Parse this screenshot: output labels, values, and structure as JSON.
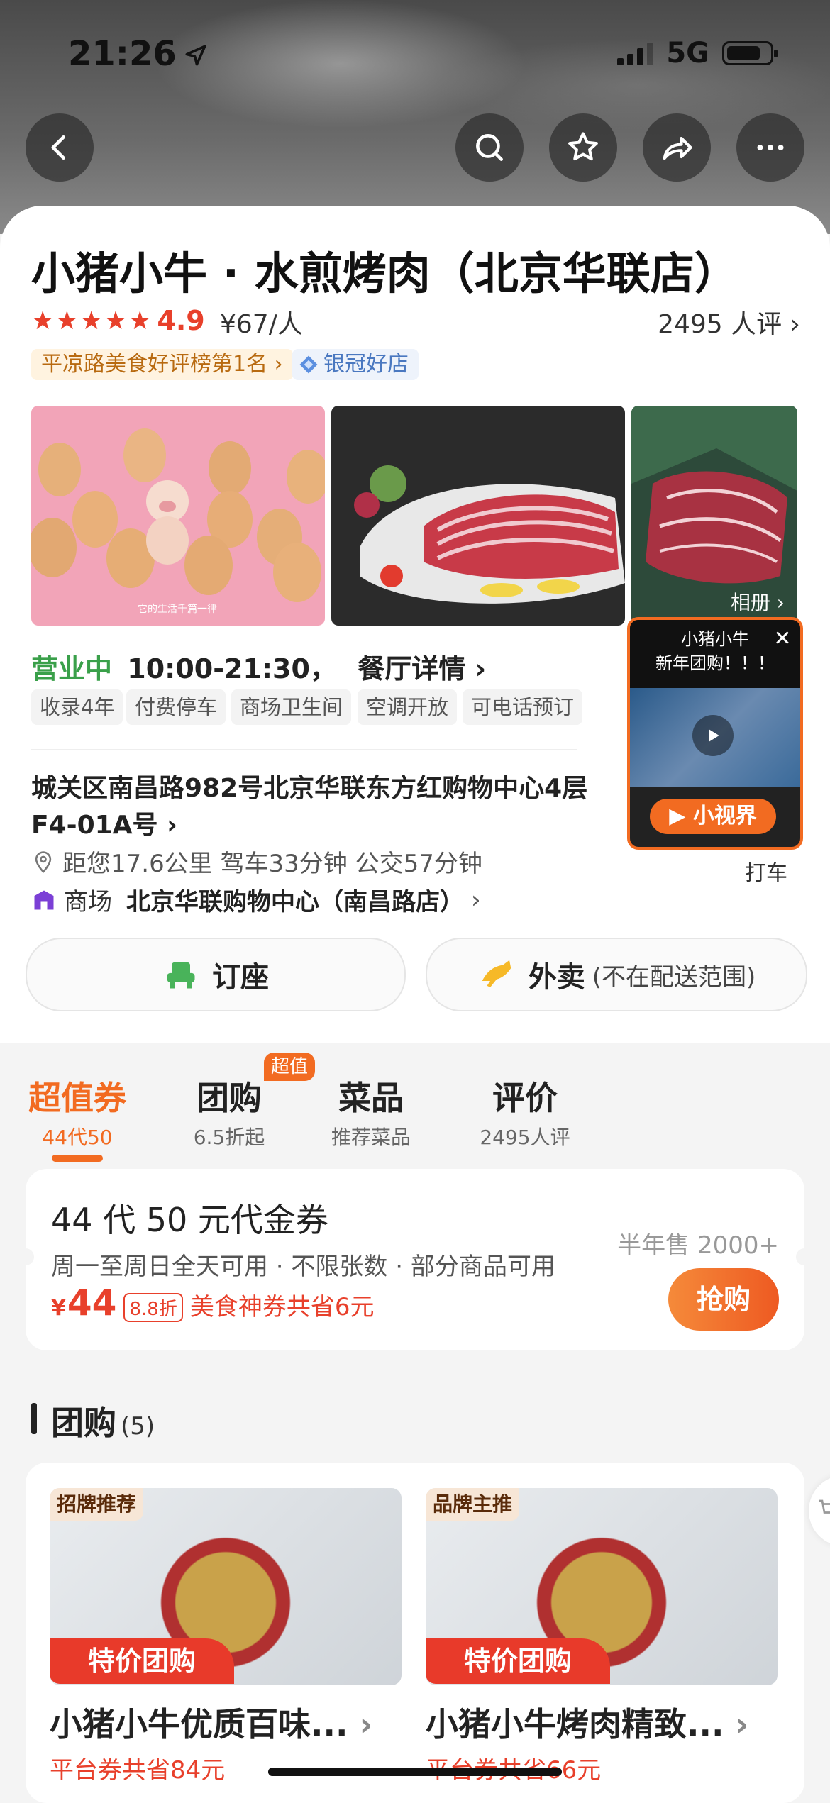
{
  "status": {
    "time": "21:26",
    "network": "5G"
  },
  "store": {
    "title": "小猪小牛 · 水煎烤肉（北京华联店）",
    "rating": "4.9",
    "price": "¥67/人",
    "reviews": "2495 人评",
    "rank_tag": "平凉路美食好评榜第1名",
    "silver_tag": "银冠好店",
    "album_label": "相册",
    "photo_caption": "它的生活千篇一律",
    "open_status": "营业中",
    "hours": "10:00-21:30，",
    "details_link": "餐厅详情",
    "features": [
      "收录4年",
      "付费停车",
      "商场卫生间",
      "空调开放",
      "可电话预订"
    ],
    "address": "城关区南昌路982号北京华联东方红购物中心4层F4-01A号",
    "distance": "距您17.6公里 驾车33分钟 公交57分钟",
    "mall_label": "商场",
    "mall_name": "北京华联购物中心（南昌路店）",
    "taxi": "打车"
  },
  "video": {
    "caption_line1": "小猪小牛",
    "caption_line2": "新年团购！！！",
    "brand": "小视界"
  },
  "actions": {
    "reserve": "订座",
    "delivery": "外卖",
    "delivery_note": "(不在配送范围)"
  },
  "tabs": [
    {
      "label": "超值券",
      "sub": "44代50"
    },
    {
      "label": "团购",
      "sub": "6.5折起",
      "badge": "超值"
    },
    {
      "label": "菜品",
      "sub": "推荐菜品"
    },
    {
      "label": "评价",
      "sub": "2495人评"
    }
  ],
  "coupon": {
    "title": "44 代 50 元代金券",
    "desc": "周一至周日全天可用 · 不限张数 · 部分商品可用",
    "price_symbol": "¥",
    "price": "44",
    "discount": "8.8折",
    "saving": "美食神券共省6元",
    "sold": "半年售 2000+",
    "buy": "抢购"
  },
  "group": {
    "title": "团购",
    "count": "(5)",
    "deals": [
      {
        "tag": "招牌推荐",
        "ribbon": "特价团购",
        "title": "小猪小牛优质百味...",
        "saving": "平台券共省84元"
      },
      {
        "tag": "品牌主推",
        "ribbon": "特价团购",
        "title": "小猪小牛烤肉精致...",
        "saving": "平台券共省66元"
      }
    ]
  }
}
